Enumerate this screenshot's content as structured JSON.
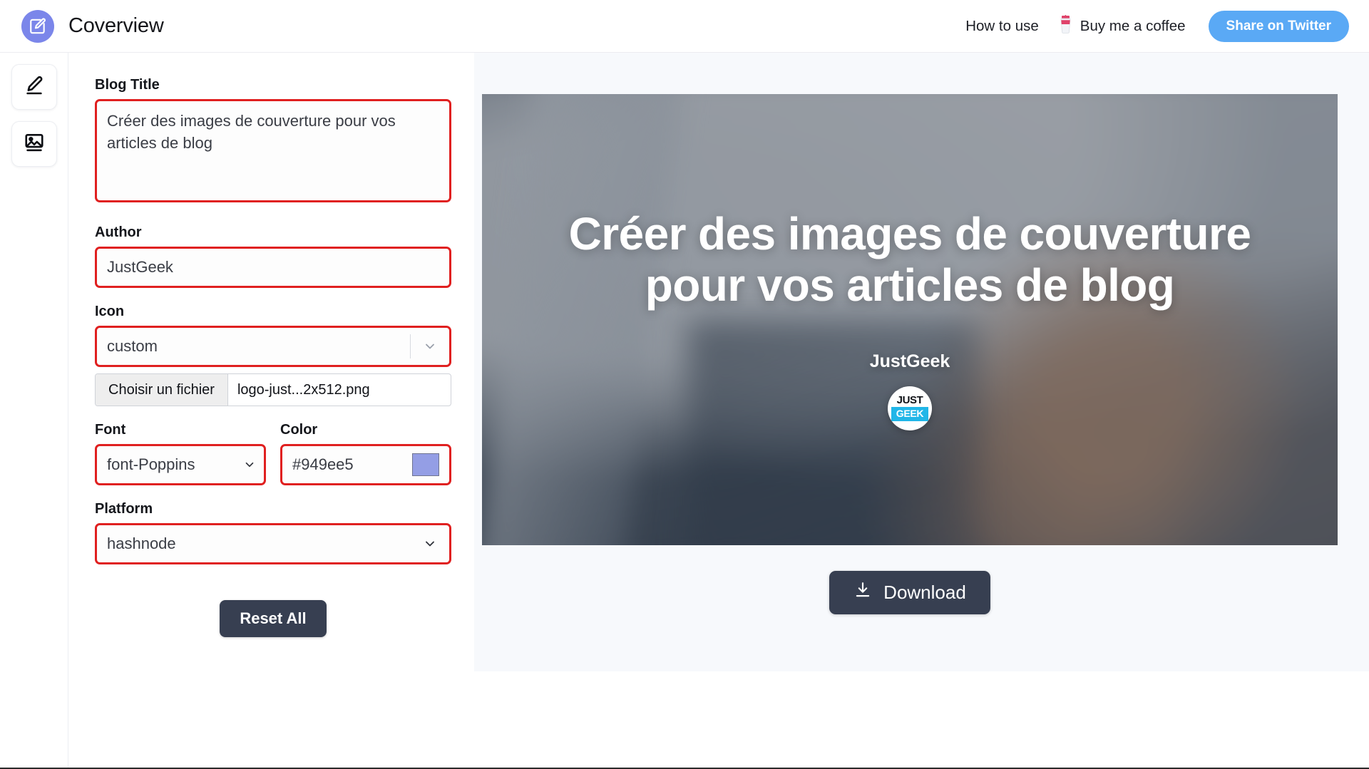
{
  "header": {
    "brand_title": "Coverview",
    "logo_icon": "edit-square-pencil-icon",
    "logo_color": "#7b86ea",
    "how_to_use": "How to use",
    "coffee_icon": "coffee-cup-icon",
    "buy_coffee": "Buy me a coffee",
    "share_twitter": "Share on Twitter",
    "twitter_btn_color": "#5aa9f5"
  },
  "rail": {
    "items": [
      {
        "icon": "pencil-edit-icon",
        "name": "editor"
      },
      {
        "icon": "image-photo-icon",
        "name": "background"
      }
    ]
  },
  "form": {
    "blog_title_label": "Blog Title",
    "blog_title_value": "Créer des images de couverture pour vos articles de blog",
    "author_label": "Author",
    "author_value": "JustGeek",
    "icon_label": "Icon",
    "icon_value": "custom",
    "file_button": "Choisir un fichier",
    "file_name": "logo-just...2x512.png",
    "font_label": "Font",
    "font_value": "font-Poppins",
    "color_label": "Color",
    "color_value": "#949ee5",
    "color_swatch": "#949ee5",
    "platform_label": "Platform",
    "platform_value": "hashnode",
    "reset_label": "Reset All",
    "highlight_color": "#e02020"
  },
  "preview": {
    "cover_title": "Créer des images de couverture pour vos articles de blog",
    "cover_author": "JustGeek",
    "logo_top_text": "JUST",
    "logo_bottom_text": "GEEK",
    "logo_accent": "#21b6e8",
    "download_label": "Download",
    "download_icon": "download-arrow-icon"
  }
}
